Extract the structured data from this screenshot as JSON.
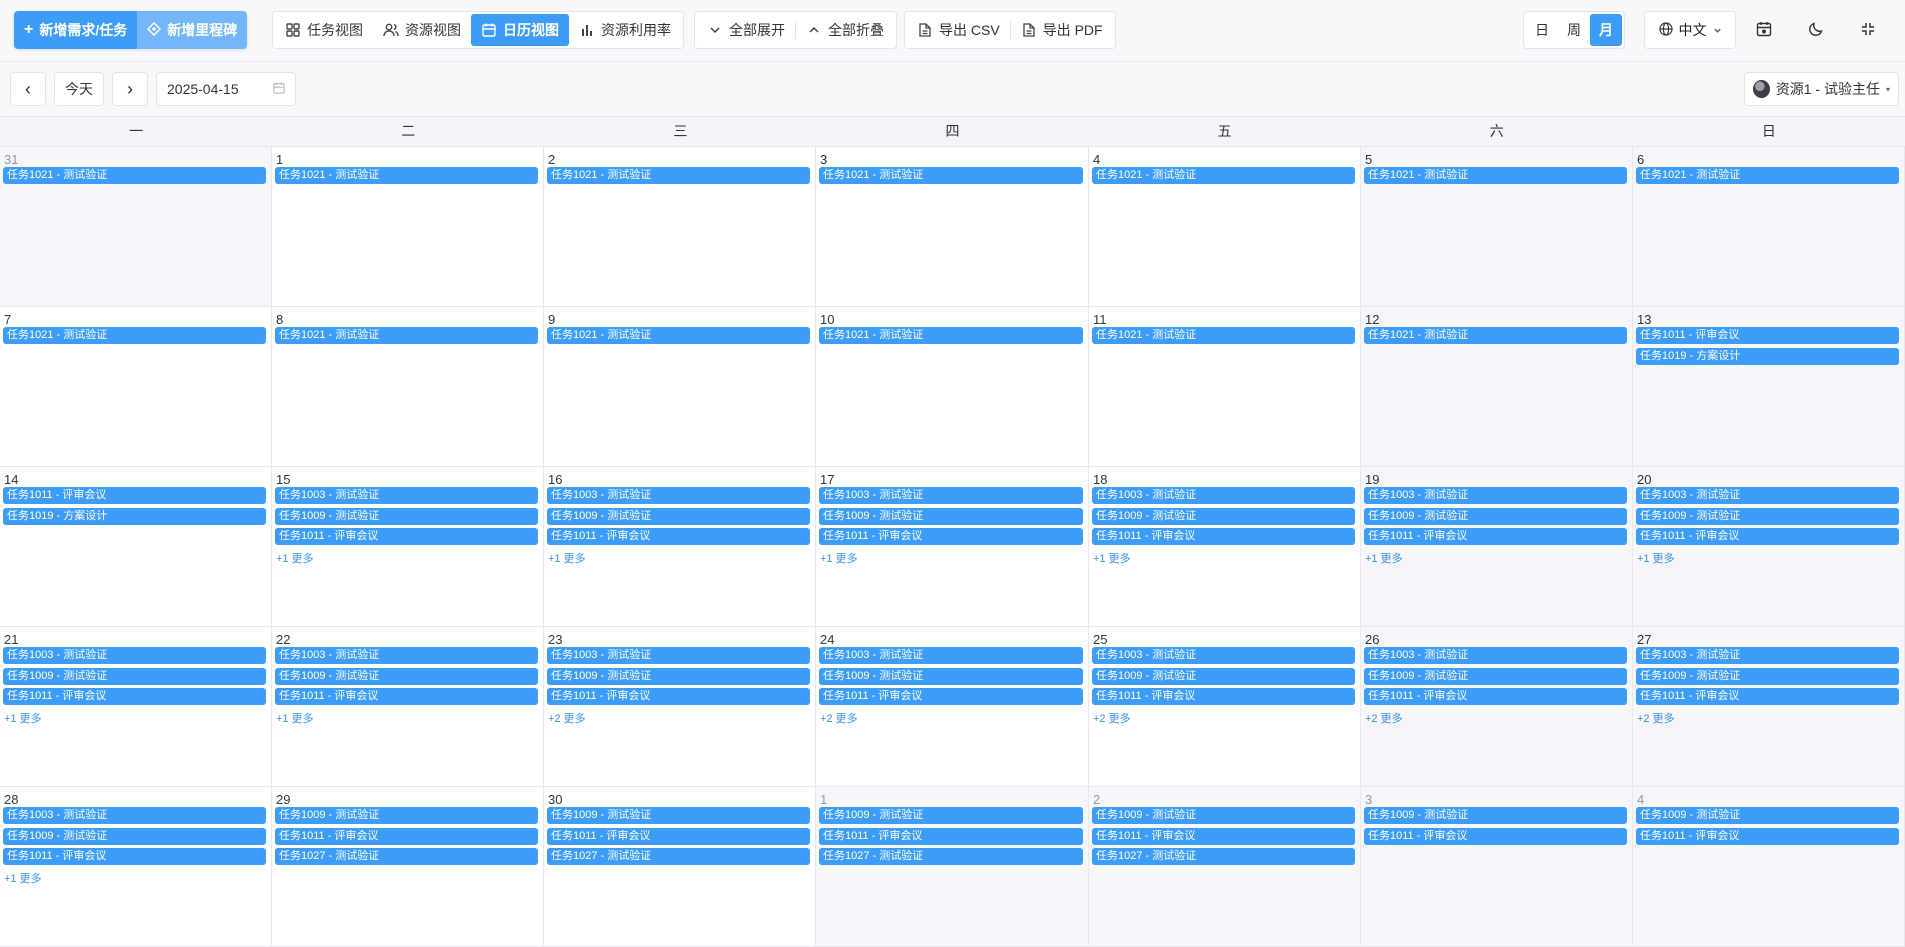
{
  "toolbar": {
    "new_task": "新增需求/任务",
    "new_milestone": "新增里程碑",
    "views": [
      {
        "label": "任务视图",
        "icon": "grid-icon",
        "active": false
      },
      {
        "label": "资源视图",
        "icon": "users-icon",
        "active": false
      },
      {
        "label": "日历视图",
        "icon": "calendar-icon",
        "active": true
      },
      {
        "label": "资源利用率",
        "icon": "bar-chart-icon",
        "active": false
      }
    ],
    "expand_all": "全部展开",
    "collapse_all": "全部折叠",
    "export_csv": "导出 CSV",
    "export_pdf": "导出 PDF",
    "scale": [
      {
        "label": "日",
        "active": false
      },
      {
        "label": "周",
        "active": false
      },
      {
        "label": "月",
        "active": true
      }
    ],
    "language": "中文"
  },
  "nav": {
    "prev": "‹",
    "today": "今天",
    "next": "›",
    "date": "2025-04-15",
    "resource": "资源1 - 试验主任"
  },
  "colors": {
    "accent": "#3d9cf5",
    "event": "#3d9cf5",
    "more_link": "#3d8fe6"
  },
  "calendar": {
    "weekdays": [
      "一",
      "二",
      "三",
      "四",
      "五",
      "六",
      "日"
    ],
    "weeks": [
      [
        {
          "day": "31",
          "other": true,
          "events": [
            "任务1021 - 测试验证"
          ],
          "more": ""
        },
        {
          "day": "1",
          "other": false,
          "events": [
            "任务1021 - 测试验证"
          ],
          "more": ""
        },
        {
          "day": "2",
          "other": false,
          "events": [
            "任务1021 - 测试验证"
          ],
          "more": ""
        },
        {
          "day": "3",
          "other": false,
          "events": [
            "任务1021 - 测试验证"
          ],
          "more": ""
        },
        {
          "day": "4",
          "other": false,
          "events": [
            "任务1021 - 测试验证"
          ],
          "more": ""
        },
        {
          "day": "5",
          "other": false,
          "events": [
            "任务1021 - 测试验证"
          ],
          "more": ""
        },
        {
          "day": "6",
          "other": false,
          "events": [
            "任务1021 - 测试验证"
          ],
          "more": ""
        }
      ],
      [
        {
          "day": "7",
          "other": false,
          "events": [
            "任务1021 - 测试验证"
          ],
          "more": ""
        },
        {
          "day": "8",
          "other": false,
          "events": [
            "任务1021 - 测试验证"
          ],
          "more": ""
        },
        {
          "day": "9",
          "other": false,
          "events": [
            "任务1021 - 测试验证"
          ],
          "more": ""
        },
        {
          "day": "10",
          "other": false,
          "events": [
            "任务1021 - 测试验证"
          ],
          "more": ""
        },
        {
          "day": "11",
          "other": false,
          "events": [
            "任务1021 - 测试验证"
          ],
          "more": ""
        },
        {
          "day": "12",
          "other": false,
          "events": [
            "任务1021 - 测试验证"
          ],
          "more": ""
        },
        {
          "day": "13",
          "other": false,
          "events": [
            "任务1011 - 评审会议",
            "任务1019 - 方案设计"
          ],
          "more": ""
        }
      ],
      [
        {
          "day": "14",
          "other": false,
          "events": [
            "任务1011 - 评审会议",
            "任务1019 - 方案设计"
          ],
          "more": ""
        },
        {
          "day": "15",
          "other": false,
          "events": [
            "任务1003 - 测试验证",
            "任务1009 - 测试验证",
            "任务1011 - 评审会议"
          ],
          "more": "+1 更多"
        },
        {
          "day": "16",
          "other": false,
          "events": [
            "任务1003 - 测试验证",
            "任务1009 - 测试验证",
            "任务1011 - 评审会议"
          ],
          "more": "+1 更多"
        },
        {
          "day": "17",
          "other": false,
          "events": [
            "任务1003 - 测试验证",
            "任务1009 - 测试验证",
            "任务1011 - 评审会议"
          ],
          "more": "+1 更多"
        },
        {
          "day": "18",
          "other": false,
          "events": [
            "任务1003 - 测试验证",
            "任务1009 - 测试验证",
            "任务1011 - 评审会议"
          ],
          "more": "+1 更多"
        },
        {
          "day": "19",
          "other": false,
          "events": [
            "任务1003 - 测试验证",
            "任务1009 - 测试验证",
            "任务1011 - 评审会议"
          ],
          "more": "+1 更多"
        },
        {
          "day": "20",
          "other": false,
          "events": [
            "任务1003 - 测试验证",
            "任务1009 - 测试验证",
            "任务1011 - 评审会议"
          ],
          "more": "+1 更多"
        }
      ],
      [
        {
          "day": "21",
          "other": false,
          "events": [
            "任务1003 - 测试验证",
            "任务1009 - 测试验证",
            "任务1011 - 评审会议"
          ],
          "more": "+1 更多"
        },
        {
          "day": "22",
          "other": false,
          "events": [
            "任务1003 - 测试验证",
            "任务1009 - 测试验证",
            "任务1011 - 评审会议"
          ],
          "more": "+1 更多"
        },
        {
          "day": "23",
          "other": false,
          "events": [
            "任务1003 - 测试验证",
            "任务1009 - 测试验证",
            "任务1011 - 评审会议"
          ],
          "more": "+2 更多"
        },
        {
          "day": "24",
          "other": false,
          "events": [
            "任务1003 - 测试验证",
            "任务1009 - 测试验证",
            "任务1011 - 评审会议"
          ],
          "more": "+2 更多"
        },
        {
          "day": "25",
          "other": false,
          "events": [
            "任务1003 - 测试验证",
            "任务1009 - 测试验证",
            "任务1011 - 评审会议"
          ],
          "more": "+2 更多"
        },
        {
          "day": "26",
          "other": false,
          "events": [
            "任务1003 - 测试验证",
            "任务1009 - 测试验证",
            "任务1011 - 评审会议"
          ],
          "more": "+2 更多"
        },
        {
          "day": "27",
          "other": false,
          "events": [
            "任务1003 - 测试验证",
            "任务1009 - 测试验证",
            "任务1011 - 评审会议"
          ],
          "more": "+2 更多"
        }
      ],
      [
        {
          "day": "28",
          "other": false,
          "events": [
            "任务1003 - 测试验证",
            "任务1009 - 测试验证",
            "任务1011 - 评审会议"
          ],
          "more": "+1 更多"
        },
        {
          "day": "29",
          "other": false,
          "events": [
            "任务1009 - 测试验证",
            "任务1011 - 评审会议",
            "任务1027 - 测试验证"
          ],
          "more": ""
        },
        {
          "day": "30",
          "other": false,
          "events": [
            "任务1009 - 测试验证",
            "任务1011 - 评审会议",
            "任务1027 - 测试验证"
          ],
          "more": ""
        },
        {
          "day": "1",
          "other": true,
          "events": [
            "任务1009 - 测试验证",
            "任务1011 - 评审会议",
            "任务1027 - 测试验证"
          ],
          "more": ""
        },
        {
          "day": "2",
          "other": true,
          "events": [
            "任务1009 - 测试验证",
            "任务1011 - 评审会议",
            "任务1027 - 测试验证"
          ],
          "more": ""
        },
        {
          "day": "3",
          "other": true,
          "events": [
            "任务1009 - 测试验证",
            "任务1011 - 评审会议"
          ],
          "more": ""
        },
        {
          "day": "4",
          "other": true,
          "events": [
            "任务1009 - 测试验证",
            "任务1011 - 评审会议"
          ],
          "more": ""
        }
      ]
    ]
  }
}
